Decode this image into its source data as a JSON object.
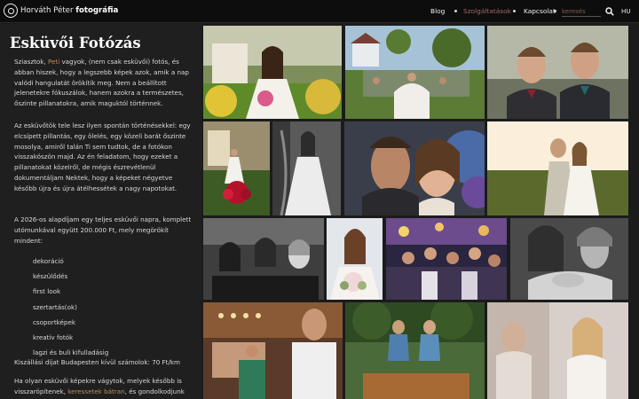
{
  "header": {
    "brand_name": "Horváth Péter",
    "brand_suffix": "fotográfia",
    "nav": [
      "Blog",
      "Szolgáltatások",
      "Kapcsolat"
    ],
    "search_placeholder": "keresés",
    "language": "HU"
  },
  "content": {
    "title": "Esküvői Fotózás",
    "intro_prefix": "Sziasztok, ",
    "intro_link": "Peti",
    "intro_suffix": " vagyok, (nem csak esküvői) fotós, és abban hiszek, hogy a legszebb képek azok, amik a nap valódi hangulatát örökítik meg. Nem a beállított jelenetekre fókuszálok, hanem azokra a természetes, őszinte pillanatokra, amik maguktól történnek.",
    "paragraph2": "Az esküvőtök tele lesz ilyen spontán történésekkel: egy elcsípett pillantás, egy ölelés, egy közeli barát őszinte mosolya, amiről talán Ti sem tudtok, de a fotókon visszaköszön majd. Az én feladatom, hogy ezeket a pillanatokat közelről, de mégis észrevétlenül dokumentáljam Nektek, hogy a képeket négyetve később újra és újra átélhessétek a nagy napotokat.",
    "paragraph3": "A 2026-os alapdíjam egy teljes esküvői napra, komplett utómunkával együtt 200.000 Ft, mely megörökít mindent:",
    "services": [
      "dekoráció",
      "készülődés",
      "first look",
      "szertartás(ok)",
      "csoportképek",
      "kreatív fotók",
      "lagzi és buli kifulladásig"
    ],
    "travel_fee": "Kiszállási díjat Budapesten kívül számolok: 70 Ft/km",
    "closing_prefix": "Ha olyan esküvői képekre vágytok, melyek később is visszaröpítenek, ",
    "closing_link": "keressetek bátran",
    "closing_suffix": ", és gondolkodjunk"
  },
  "gallery": [
    "bride-with-bouquet",
    "wedding-guests-outdoors",
    "groom-and-groomsman",
    "bride-at-house",
    "bride-in-gown-bw",
    "kissing-couple-closeup",
    "couple-sunset-embrace",
    "laughing-women-bw",
    "bride-smiling-bouquet",
    "party-crowd",
    "bride-holding-hands-bw",
    "groom-with-officiant",
    "couple-on-bench-back",
    "bride-smiling-veil"
  ],
  "colors": {
    "background": "#1b1b1b",
    "topbar": "#0d0d0d",
    "link": "#b98b5f",
    "nav_muted": "#9a6a6a"
  }
}
